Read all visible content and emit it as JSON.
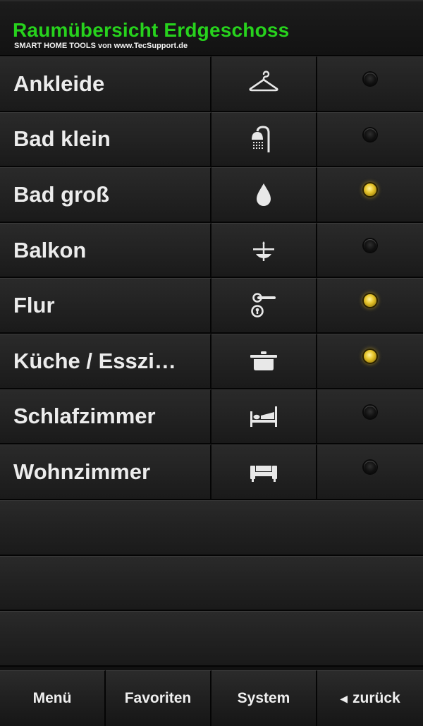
{
  "header": {
    "title": "Raumübersicht Erdgeschoss",
    "subtitle": "SMART HOME TOOLS von www.TecSupport.de"
  },
  "rooms": [
    {
      "label": "Ankleide",
      "icon": "hanger-icon",
      "status": "off"
    },
    {
      "label": "Bad klein",
      "icon": "shower-icon",
      "status": "off"
    },
    {
      "label": "Bad groß",
      "icon": "water-drop-icon",
      "status": "on"
    },
    {
      "label": "Balkon",
      "icon": "patio-table-icon",
      "status": "off"
    },
    {
      "label": "Flur",
      "icon": "door-handle-icon",
      "status": "on"
    },
    {
      "label": "Küche / Esszi…",
      "icon": "cooking-pot-icon",
      "status": "on"
    },
    {
      "label": "Schlafzimmer",
      "icon": "bed-icon",
      "status": "off"
    },
    {
      "label": "Wohnzimmer",
      "icon": "sofa-icon",
      "status": "off"
    }
  ],
  "colors": {
    "title": "#27d21d",
    "led_on": "#e7c52c",
    "led_off": "#111111"
  },
  "footer": {
    "menu_label": "Menü",
    "favorites_label": "Favoriten",
    "system_label": "System",
    "back_label": "zurück"
  }
}
